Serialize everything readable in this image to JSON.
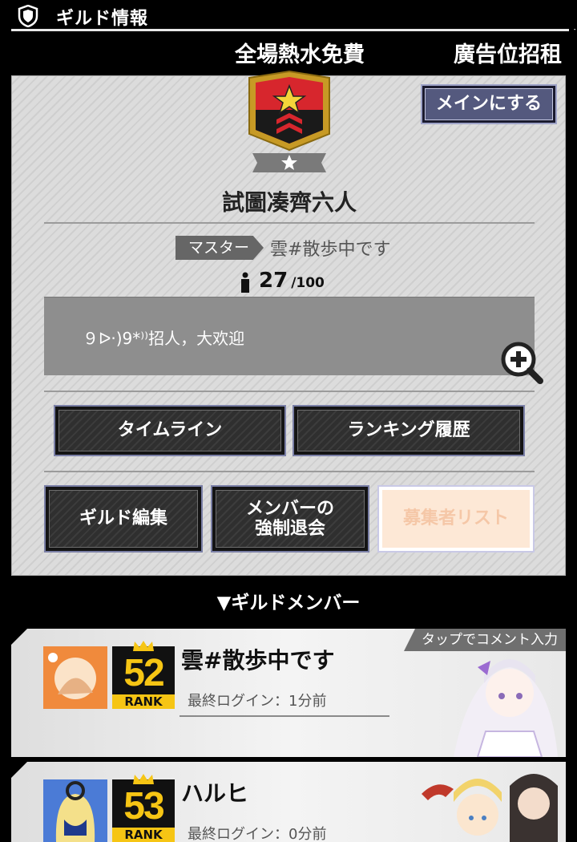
{
  "header": {
    "title": "ギルド情報"
  },
  "marquee": {
    "left": "全場熱水免費",
    "right": "廣告位招租"
  },
  "guild": {
    "main_button": "メインにする",
    "name": "試圖凑齊六人",
    "master_tag": "マスター",
    "master_name": "雲#散歩中です",
    "member_count": "27",
    "member_max": "/100",
    "comment": "９ᐅ·)9*⁾⁾招人，大欢迎"
  },
  "buttons": {
    "timeline": "タイムライン",
    "ranking_history": "ランキング履歴",
    "guild_edit": "ギルド編集",
    "force_leave_line1": "メンバーの",
    "force_leave_line2": "強制退会",
    "applicant_list": "募集者リスト"
  },
  "members_section": {
    "title": "▼ギルドメンバー"
  },
  "members": [
    {
      "tap_hint": "タップでコメント入力",
      "rank": "52",
      "rank_label": "RANK",
      "name": "雲#散歩中です",
      "last_login": "最終ログイン：1分前"
    },
    {
      "rank": "53",
      "rank_label": "RANK",
      "name": "ハルヒ",
      "last_login": "最終ログイン：0分前"
    }
  ],
  "colors": {
    "accent_gold": "#f6c514",
    "button_border": "#7a7fa6",
    "emblem_red": "#d7262d"
  }
}
